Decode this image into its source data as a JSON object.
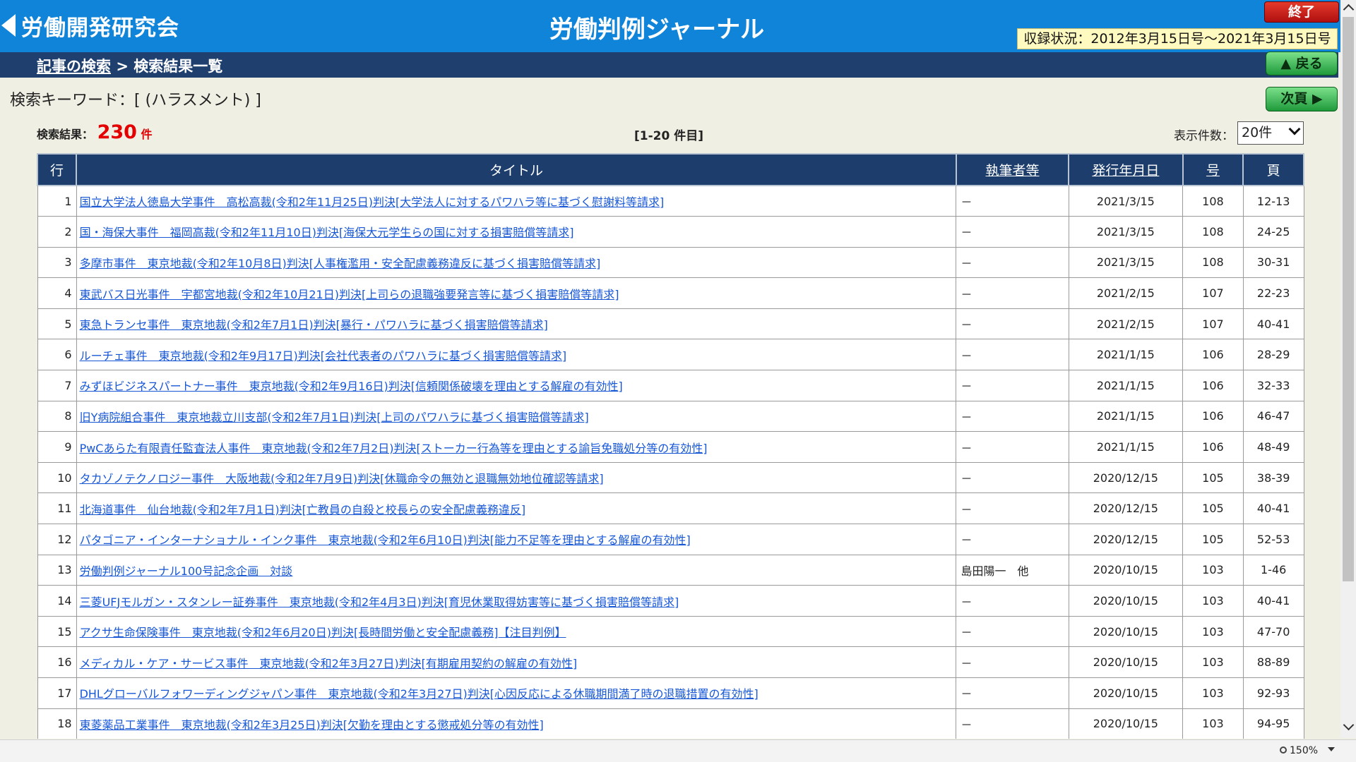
{
  "header": {
    "logo_text": "労働開発研究会",
    "app_title": "労働判例ジャーナル",
    "exit_label": "終了",
    "coverage": "収録状況：2012年3月15日号～2021年3月15日号"
  },
  "breadcrumb": {
    "link_label": "記事の検索",
    "separator": ">",
    "current": "検索結果一覧"
  },
  "buttons": {
    "back_label": "戻る",
    "next_label": "次頁"
  },
  "search": {
    "keyword_label": "検索キーワード：[ (ハラスメント) ]",
    "result_label": "検索結果：",
    "result_count": "230",
    "result_unit": "件",
    "range": "[1-20 件目]",
    "per_page_label": "表示件数：",
    "per_page_value": "20件"
  },
  "table": {
    "headers": [
      "行",
      "タイトル",
      "執筆者等",
      "発行年月日",
      "号",
      "頁"
    ],
    "rows": [
      {
        "n": "1",
        "title": "国立大学法人徳島大学事件　高松高裁(令和2年11月25日)判決[大学法人に対するパワハラ等に基づく慰謝料等請求]",
        "author": "－",
        "date": "2021/3/15",
        "issue": "108",
        "page": "12-13"
      },
      {
        "n": "2",
        "title": "国・海保大事件　福岡高裁(令和2年11月10日)判決[海保大元学生らの国に対する損害賠償等請求]",
        "author": "－",
        "date": "2021/3/15",
        "issue": "108",
        "page": "24-25"
      },
      {
        "n": "3",
        "title": "多摩市事件　東京地裁(令和2年10月8日)判決[人事権濫用・安全配慮義務違反に基づく損害賠償等請求]",
        "author": "－",
        "date": "2021/3/15",
        "issue": "108",
        "page": "30-31"
      },
      {
        "n": "4",
        "title": "東武バス日光事件　宇都宮地裁(令和2年10月21日)判決[上司らの退職強要発言等に基づく損害賠償等請求]",
        "author": "－",
        "date": "2021/2/15",
        "issue": "107",
        "page": "22-23"
      },
      {
        "n": "5",
        "title": "東急トランセ事件　東京地裁(令和2年7月1日)判決[暴行・パワハラに基づく損害賠償等請求]",
        "author": "－",
        "date": "2021/2/15",
        "issue": "107",
        "page": "40-41"
      },
      {
        "n": "6",
        "title": "ルーチェ事件　東京地裁(令和2年9月17日)判決[会社代表者のパワハラに基づく損害賠償等請求]",
        "author": "－",
        "date": "2021/1/15",
        "issue": "106",
        "page": "28-29"
      },
      {
        "n": "7",
        "title": "みずほビジネスパートナー事件　東京地裁(令和2年9月16日)判決[信頼関係破壊を理由とする解雇の有効性]",
        "author": "－",
        "date": "2021/1/15",
        "issue": "106",
        "page": "32-33"
      },
      {
        "n": "8",
        "title": "旧Y病院組合事件　東京地裁立川支部(令和2年7月1日)判決[上司のパワハラに基づく損害賠償等請求]",
        "author": "－",
        "date": "2021/1/15",
        "issue": "106",
        "page": "46-47"
      },
      {
        "n": "9",
        "title": "PwCあらた有限責任監査法人事件　東京地裁(令和2年7月2日)判決[ストーカー行為等を理由とする諭旨免職処分等の有効性]",
        "author": "－",
        "date": "2021/1/15",
        "issue": "106",
        "page": "48-49"
      },
      {
        "n": "10",
        "title": "タカゾノテクノロジー事件　大阪地裁(令和2年7月9日)判決[休職命令の無効と退職無効地位確認等請求]",
        "author": "－",
        "date": "2020/12/15",
        "issue": "105",
        "page": "38-39"
      },
      {
        "n": "11",
        "title": "北海道事件　仙台地裁(令和2年7月1日)判決[亡教員の自殺と校長らの安全配慮義務違反]",
        "author": "－",
        "date": "2020/12/15",
        "issue": "105",
        "page": "40-41"
      },
      {
        "n": "12",
        "title": "パタゴニア・インターナショナル・インク事件　東京地裁(令和2年6月10日)判決[能力不足等を理由とする解雇の有効性]",
        "author": "－",
        "date": "2020/12/15",
        "issue": "105",
        "page": "52-53"
      },
      {
        "n": "13",
        "title": "労働判例ジャーナル100号記念企画　対談",
        "author": "島田陽一　他",
        "date": "2020/10/15",
        "issue": "103",
        "page": "1-46"
      },
      {
        "n": "14",
        "title": "三菱UFJモルガン・スタンレー証券事件　東京地裁(令和2年4月3日)判決[育児休業取得妨害等に基づく損害賠償等請求]",
        "author": "－",
        "date": "2020/10/15",
        "issue": "103",
        "page": "40-41"
      },
      {
        "n": "15",
        "title": "アクサ生命保険事件　東京地裁(令和2年6月20日)判決[長時間労働と安全配慮義務]【注目判例】",
        "author": "－",
        "date": "2020/10/15",
        "issue": "103",
        "page": "47-70"
      },
      {
        "n": "16",
        "title": "メディカル・ケア・サービス事件　東京地裁(令和2年3月27日)判決[有期雇用契約の解雇の有効性]",
        "author": "－",
        "date": "2020/10/15",
        "issue": "103",
        "page": "88-89"
      },
      {
        "n": "17",
        "title": "DHLグローバルフォワーディングジャパン事件　東京地裁(令和2年3月27日)判決[心因反応による休職期間満了時の退職措置の有効性]",
        "author": "－",
        "date": "2020/10/15",
        "issue": "103",
        "page": "92-93"
      },
      {
        "n": "18",
        "title": "東菱薬品工業事件　東京地裁(令和2年3月25日)判決[欠勤を理由とする懲戒処分等の有効性]",
        "author": "－",
        "date": "2020/10/15",
        "issue": "103",
        "page": "94-95"
      },
      {
        "n": "",
        "title": "",
        "author": "",
        "date": "",
        "issue": "",
        "page": ""
      }
    ]
  },
  "statusbar": {
    "zoom": "150%"
  },
  "colors": {
    "header_bg": "#0f84d9",
    "crumb_bg": "#1f3f6e",
    "table_header_bg": "#1d3e6d",
    "link": "#1757d6",
    "result_red": "#e40000"
  }
}
